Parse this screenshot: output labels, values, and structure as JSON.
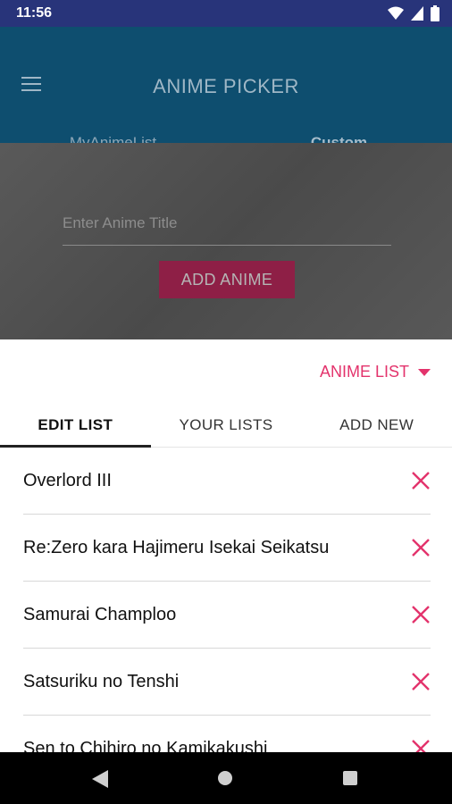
{
  "status": {
    "time": "11:56"
  },
  "app": {
    "title": "ANIME PICKER"
  },
  "tabs": [
    {
      "label": "MyAnimeList"
    },
    {
      "label": "Custom"
    }
  ],
  "form": {
    "placeholder": "Enter Anime Title",
    "add_button": "ADD ANIME"
  },
  "sheet": {
    "dropdown_label": "ANIME LIST",
    "tabs": [
      {
        "label": "EDIT LIST"
      },
      {
        "label": "YOUR LISTS"
      },
      {
        "label": "ADD NEW"
      }
    ],
    "items": [
      {
        "name": "Overlord III"
      },
      {
        "name": "Re:Zero kara Hajimeru Isekai Seikatsu"
      },
      {
        "name": "Samurai Champloo"
      },
      {
        "name": "Satsuriku no Tenshi"
      },
      {
        "name": "Sen to Chihiro no Kamikakushi"
      }
    ]
  },
  "colors": {
    "accent": "#e3336c",
    "appbar": "#0e4e6f",
    "statusbar": "#28347a"
  },
  "icons": {
    "menu": "menu-icon",
    "remove": "close-icon",
    "wifi": "wifi-icon",
    "signal": "signal-icon",
    "battery": "battery-icon"
  }
}
